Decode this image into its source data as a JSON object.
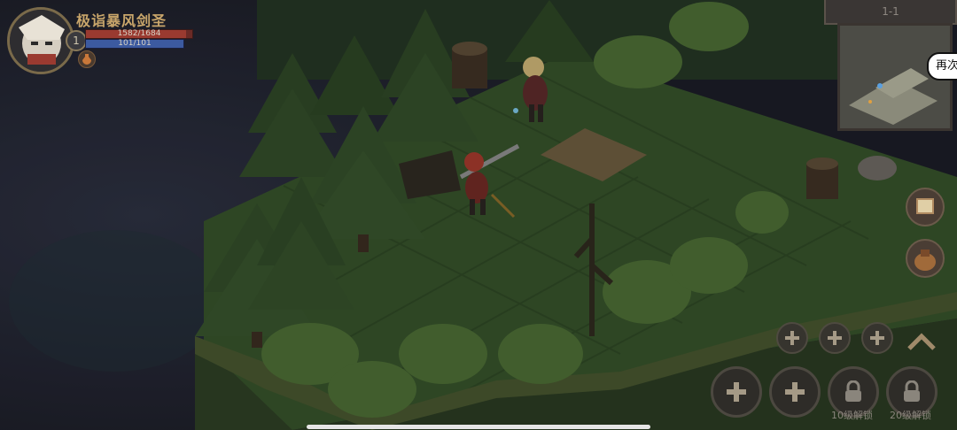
{
  "hud": {
    "title": "极诣暴风剑圣",
    "level": "1",
    "hp_text": "1582/1684",
    "hp_fraction": 0.94,
    "mp_text": "101/101",
    "mp_fraction": 1.0
  },
  "minimap": {
    "stage": "1-1"
  },
  "retry_bubble": {
    "label": "再次"
  },
  "skill_slots": {
    "unlock_10": "10级解锁",
    "unlock_20": "20级解锁"
  },
  "icons": {
    "portrait": "hero-portrait-icon",
    "potion": "potion-icon",
    "plus": "plus-icon",
    "lock": "lock-icon",
    "expand": "chevron-up-icon",
    "book": "book-icon",
    "bag": "bag-icon"
  },
  "colors": {
    "title": "#c9a66b",
    "hp": "#9a3a30",
    "mp": "#3c5aa0",
    "grass": "#3b5a2c"
  }
}
